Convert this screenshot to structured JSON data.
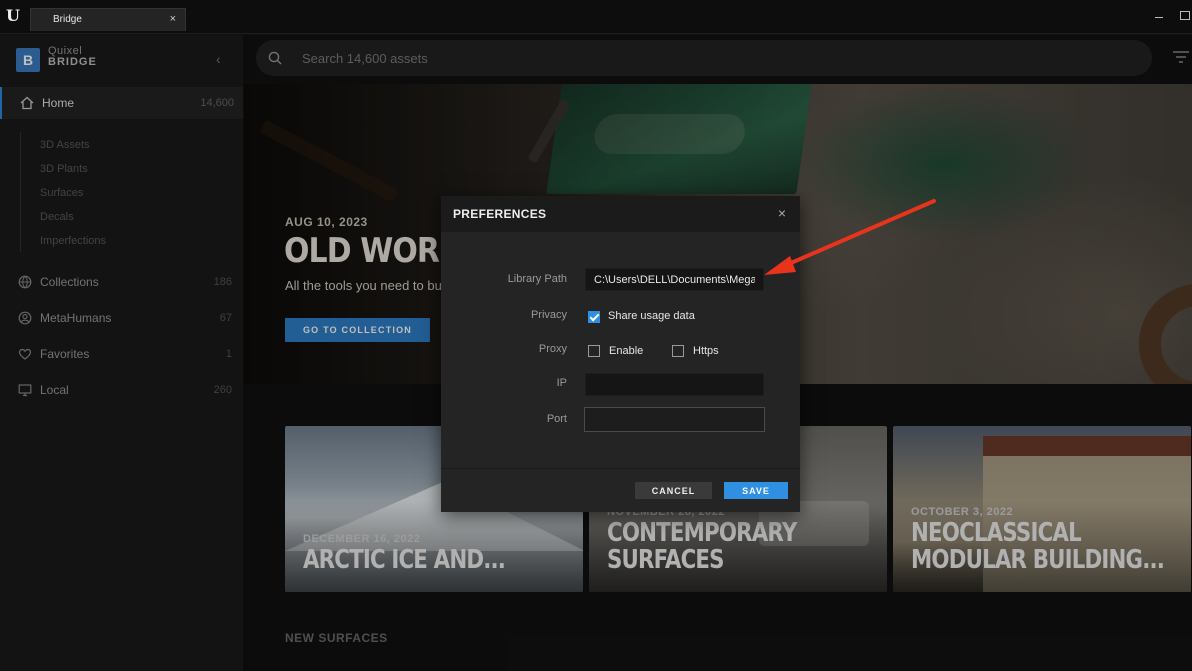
{
  "window": {
    "tab_label": "Bridge",
    "tab_close": "×"
  },
  "sidebar": {
    "brand_line1": "Quixel",
    "brand_line2": "BRIDGE",
    "brand_logo": "B",
    "collapse": "‹",
    "home": {
      "label": "Home",
      "count": "14,600",
      "icon": "home-icon"
    },
    "subitems": [
      "3D Assets",
      "3D Plants",
      "Surfaces",
      "Decals",
      "Imperfections"
    ],
    "items": [
      {
        "label": "Collections",
        "count": "186",
        "icon": "globe-icon"
      },
      {
        "label": "MetaHumans",
        "count": "67",
        "icon": "person-icon"
      },
      {
        "label": "Favorites",
        "count": "1",
        "icon": "heart-icon"
      },
      {
        "label": "Local",
        "count": "260",
        "icon": "monitor-icon"
      }
    ]
  },
  "search": {
    "placeholder": "Search 14,600 assets",
    "value": ""
  },
  "hero": {
    "date": "AUG 10, 2023",
    "title": "OLD WORKS",
    "description": "All the tools you need to bui",
    "button_label": "GO TO COLLECTION"
  },
  "cards": [
    {
      "date": "DECEMBER 16, 2022",
      "title": "ARCTIC ICE AND..."
    },
    {
      "date": "NOVEMBER 28, 2022",
      "title": "CONTEMPORARY SURFACES"
    },
    {
      "date": "OCTOBER 3, 2022",
      "title": "NEOCLASSICAL MODULAR BUILDING..."
    }
  ],
  "section_title": "NEW SURFACES",
  "dialog": {
    "title": "PREFERENCES",
    "close": "×",
    "library_path_label": "Library Path",
    "library_path_value": "C:\\Users\\DELL\\Documents\\Mega",
    "privacy_label": "Privacy",
    "share_usage_label": "Share usage data",
    "share_usage_checked": true,
    "proxy_label": "Proxy",
    "enable_label": "Enable",
    "enable_checked": false,
    "https_label": "Https",
    "https_checked": false,
    "ip_label": "IP",
    "ip_value": "",
    "port_label": "Port",
    "port_value": "",
    "cancel_label": "CANCEL",
    "save_label": "SAVE"
  },
  "colors": {
    "accent": "#2f8fe0",
    "annotation_arrow": "#e8341c"
  }
}
